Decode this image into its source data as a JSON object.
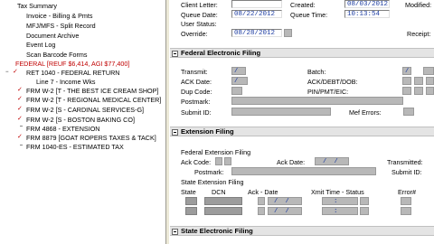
{
  "tree": {
    "items": [
      {
        "label": "Tax Summary"
      },
      {
        "label": "Invoice - Billing & Pmts"
      },
      {
        "label": "MFJ/MFS - Split Record"
      },
      {
        "label": "Document Archive"
      },
      {
        "label": "Event Log"
      },
      {
        "label": "Scan Barcode Forms"
      },
      {
        "label": "FEDERAL [REUF $6,414, AGI $77,400]"
      },
      {
        "label": "RET 1040 - FEDERAL RETURN"
      },
      {
        "label": "Line 7 - Income Wks"
      },
      {
        "label": "FRM W-2 [T - THE BEST ICE CREAM SHOP]"
      },
      {
        "label": "FRM W-2 [T - REGIONAL MEDICAL CENTER]"
      },
      {
        "label": "FRM W-2 [S - CARDINAL SERVICES-G]"
      },
      {
        "label": "FRM W-2 [S - BOSTON BAKING CO]"
      },
      {
        "label": "FRM 4868 - EXTENSION"
      },
      {
        "label": "FRM 8879 [GOAT ROPERS TAXES & TACK]"
      },
      {
        "label": "FRM 1040-ES - ESTIMATED TAX"
      }
    ],
    "check_mark": "✓",
    "expand_mark": "−"
  },
  "header": {
    "client_letter_label": "Client Letter:",
    "created_label": "Created:",
    "created_value": "08/03/2012",
    "modified_label": "Modified:",
    "queue_date_label": "Queue Date:",
    "queue_date_value": "08/22/2012",
    "queue_time_label": "Queue Time:",
    "queue_time_value": "10:13:54",
    "user_status_label": "User Status:",
    "override_label": "Override:",
    "override_value": "08/28/2012",
    "receipt_label": "Receipt:"
  },
  "federal": {
    "title": "Federal Electronic Filing",
    "transmit_label": "Transmit:",
    "batch_label": "Batch:",
    "ack_date_label": "ACK Date:",
    "ack_debt_dob_label": "ACK/DEBT/DOB:",
    "dup_code_label": "Dup Code:",
    "pin_pmt_eic_label": "PIN/PMT/EIC:",
    "postmark_label": "Postmark:",
    "submit_id_label": "Submit ID:",
    "mef_errors_label": "Mef Errors:"
  },
  "extension": {
    "title": "Extension Filing",
    "fed_ext_label": "Federal Extension Filing",
    "ack_code_label": "Ack Code:",
    "ack_date_label": "Ack Date:",
    "transmitted_label": "Transmitted:",
    "postmark_label": "Postmark:",
    "submit_id_label": "Submit ID:",
    "state_ext_label": "State Extension Filing",
    "col_state": "State",
    "col_dcn": "DCN",
    "col_ack": "Ack - Date",
    "col_xmit": "Xmit Time - Status",
    "col_error": "Error#"
  },
  "state": {
    "title": "State Electronic Filing"
  },
  "slash": "/",
  "colon": ":"
}
